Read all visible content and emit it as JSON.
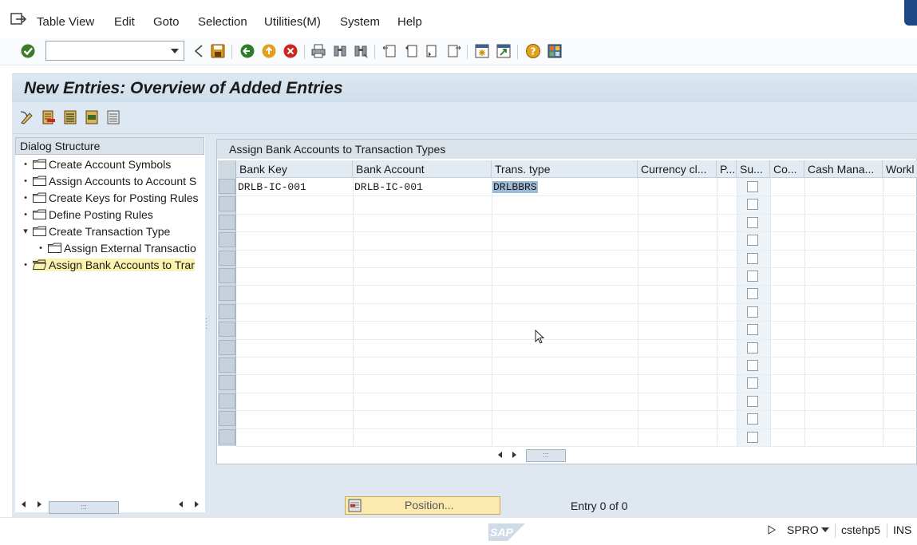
{
  "menubar": {
    "items": [
      "Table View",
      "Edit",
      "Goto",
      "Selection",
      "Utilities(M)",
      "System",
      "Help"
    ]
  },
  "toolbar": {
    "command_field_value": "",
    "icons": [
      "enter-icon",
      "back-icon",
      "save-icon",
      "back-green-icon",
      "exit-icon",
      "cancel-icon",
      "print-icon",
      "find-icon",
      "find-next-icon",
      "first-page-icon",
      "previous-page-icon",
      "next-page-icon",
      "last-page-icon",
      "create-session-icon",
      "shortcut-icon",
      "help-icon",
      "customize-layout-icon"
    ]
  },
  "title": "New Entries: Overview of Added Entries",
  "app_toolbar": {
    "icons": [
      "change-display-icon",
      "delete-icon",
      "select-all-icon",
      "select-block-icon",
      "deselect-all-icon"
    ]
  },
  "dialog_structure": {
    "header": "Dialog Structure",
    "items": [
      {
        "label": "Create Account Symbols",
        "level": 0,
        "selected": false
      },
      {
        "label": "Assign Accounts to Account S",
        "level": 0,
        "selected": false
      },
      {
        "label": "Create Keys for Posting Rules",
        "level": 0,
        "selected": false
      },
      {
        "label": "Define Posting Rules",
        "level": 0,
        "selected": false
      },
      {
        "label": "Create Transaction Type",
        "level": 0,
        "expanded": true,
        "selected": false
      },
      {
        "label": "Assign External Transactio",
        "level": 1,
        "selected": false
      },
      {
        "label": "Assign Bank Accounts to Trar",
        "level": 0,
        "selected": true
      }
    ]
  },
  "table": {
    "title": "Assign Bank Accounts to Transaction Types",
    "columns": [
      "Bank Key",
      "Bank Account",
      "Trans. type",
      "Currency cl...",
      "P...",
      "Su...",
      "Co...",
      "Cash Mana...",
      "Workl"
    ],
    "rows": [
      {
        "bank_key": "DRLB-IC-001",
        "bank_account": "DRLB-IC-001",
        "trans_type": "DRLBBRS"
      }
    ],
    "empty_rows": 14
  },
  "position_button": "Position...",
  "entry_text": "Entry 0 of 0",
  "status": {
    "logo": "SAP",
    "transaction": "SPRO",
    "server": "cstehp5",
    "mode": "INS"
  },
  "colors": {
    "title_bg": "#d5e3ee",
    "selected_tree_item": "#fdf3b0",
    "highlight_cell": "#9dbbd6",
    "position_button": "#fbe9b0"
  }
}
